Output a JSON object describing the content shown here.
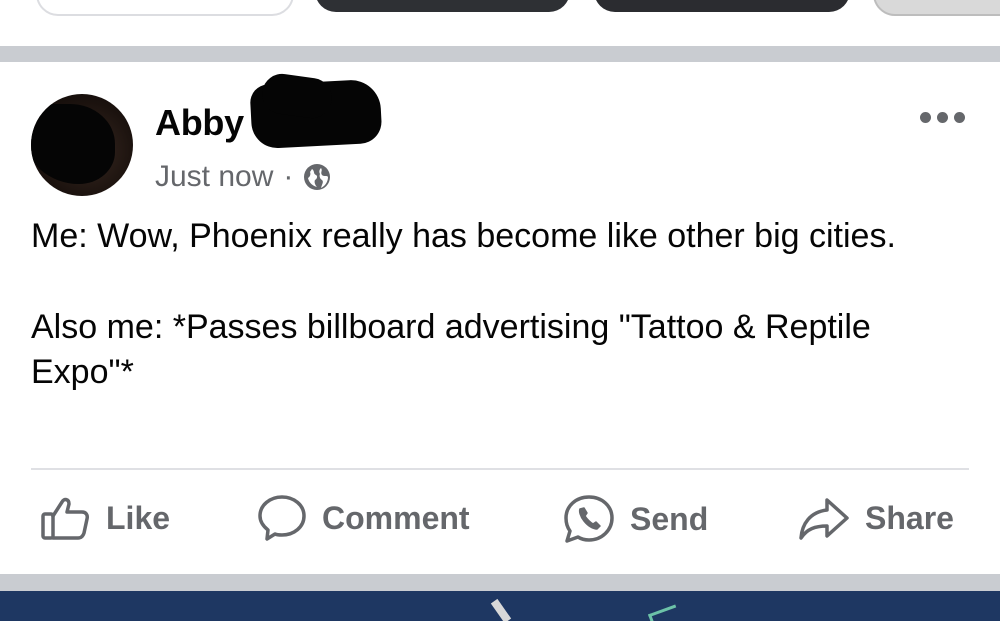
{
  "post": {
    "author_name": "Abby",
    "timestamp": "Just now",
    "separator": "·",
    "privacy_icon": "globe-icon",
    "options_icon": "more-options-icon",
    "body_paragraphs": [
      "Me: Wow, Phoenix really has become like other big cities.",
      "Also me: *Passes billboard advertising \"Tattoo & Reptile Expo\"*"
    ]
  },
  "actions": {
    "like_label": "Like",
    "comment_label": "Comment",
    "send_label": "Send",
    "share_label": "Share"
  },
  "colors": {
    "secondary_text": "#65676b",
    "separator": "#c9ccd1",
    "next_post_banner": "#1e3762"
  }
}
